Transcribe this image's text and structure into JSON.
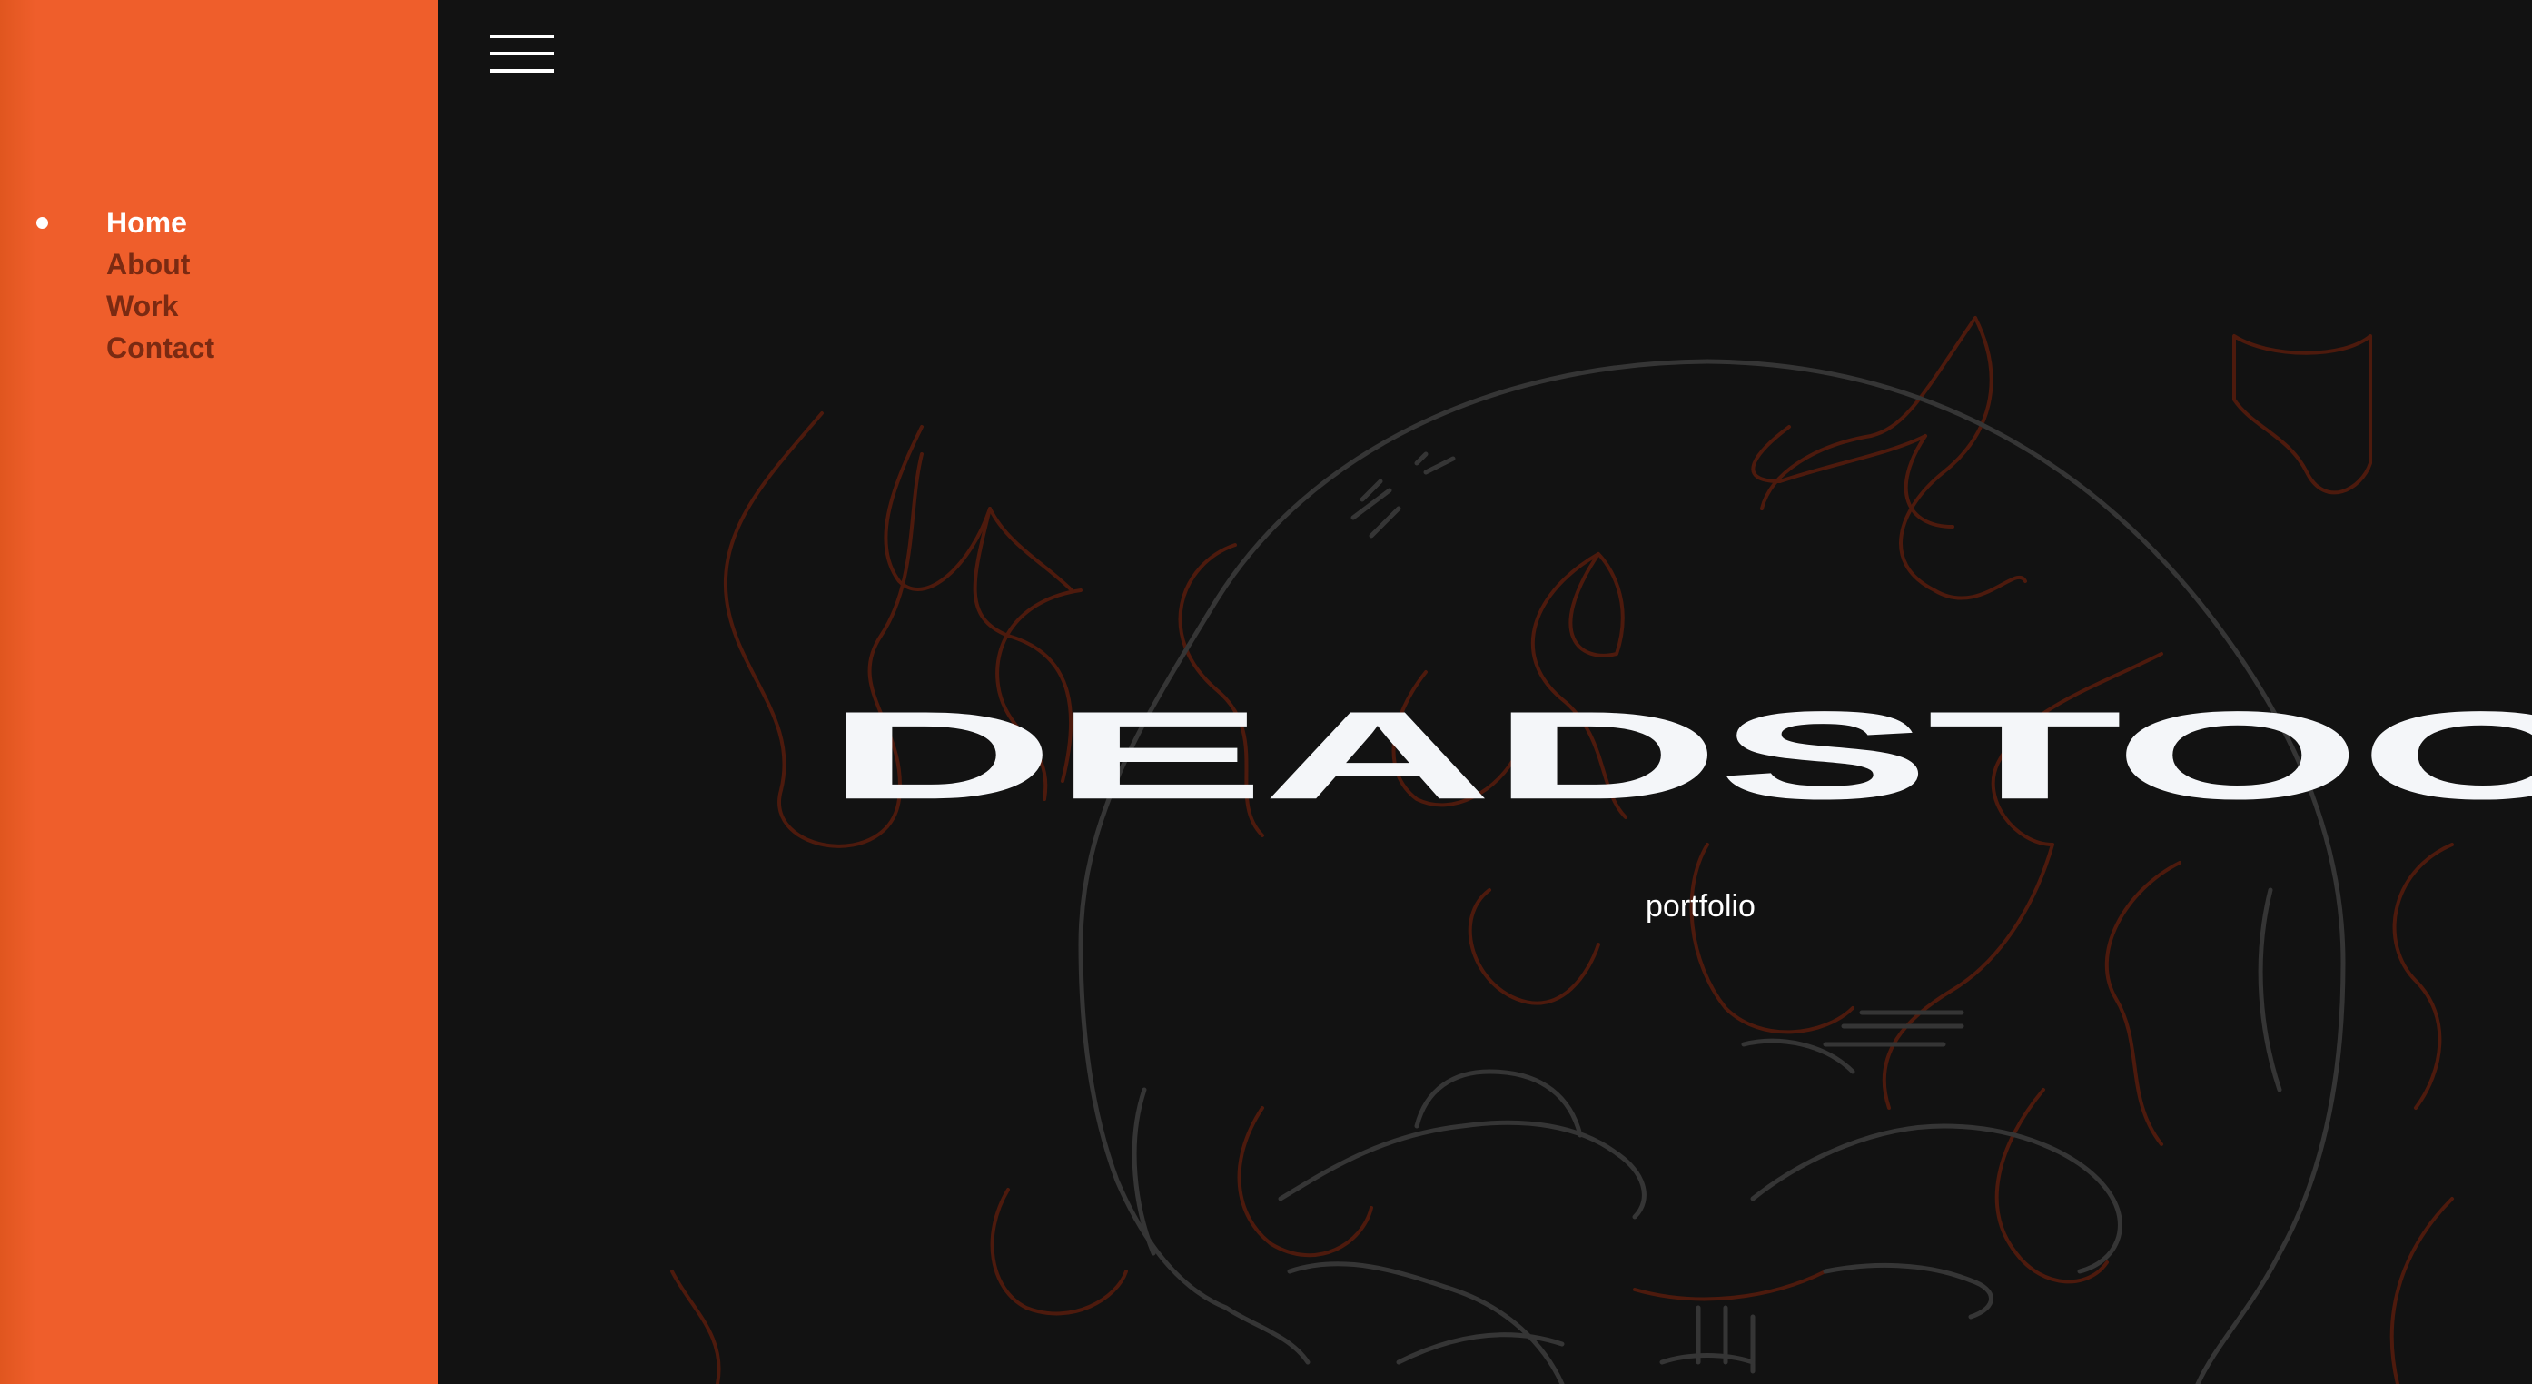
{
  "sidebar": {
    "background_color": "#ef5e2b",
    "nav": [
      {
        "label": "Home",
        "active": true
      },
      {
        "label": "About",
        "active": false
      },
      {
        "label": "Work",
        "active": false
      },
      {
        "label": "Contact",
        "active": false
      }
    ],
    "active_indicator": "bullet-dot-icon"
  },
  "header": {
    "menu_icon": "hamburger-menu-icon"
  },
  "hero": {
    "title": "DEADSTOCK",
    "subtitle": "portfolio",
    "background_color": "#121212",
    "title_color": "#f4f6f9",
    "artwork_description_icon": "skull-with-flames-line-art",
    "flame_line_color": "#5a1e10",
    "skull_line_color": "#3a3a3a"
  }
}
